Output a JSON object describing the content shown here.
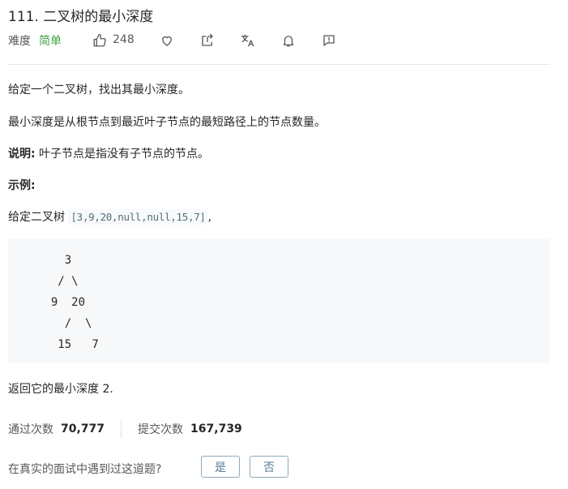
{
  "problem": {
    "title": "111. 二叉树的最小深度",
    "difficulty_label": "难度",
    "difficulty": "简单",
    "likes": "248"
  },
  "icons": [
    "thumbs-up-icon",
    "heart-icon",
    "share-icon",
    "translate-icon",
    "bell-icon",
    "feedback-icon"
  ],
  "content": {
    "p1": "给定一个二叉树，找出其最小深度。",
    "p2": "最小深度是从根节点到最近叶子节点的最短路径上的节点数量。",
    "note_label": "说明:",
    "note_text": " 叶子节点是指没有子节点的节点。",
    "example_label": "示例:",
    "example_prefix": "给定二叉树 ",
    "example_code": "[3,9,20,null,null,15,7]",
    "example_suffix": ",",
    "tree": "    3\n   / \\\n  9  20\n    /  \\\n   15   7",
    "result": "返回它的最小深度  2."
  },
  "stats": {
    "accepted_label": "通过次数",
    "accepted_value": "70,777",
    "submitted_label": "提交次数",
    "submitted_value": "167,739"
  },
  "interview": {
    "question": "在真实的面试中遇到过这道题?",
    "yes_label": "是",
    "no_label": "否"
  },
  "colors": {
    "easy": "#43a047",
    "button_border": "#8fa9bd",
    "code_bg": "#f7f8fa"
  }
}
